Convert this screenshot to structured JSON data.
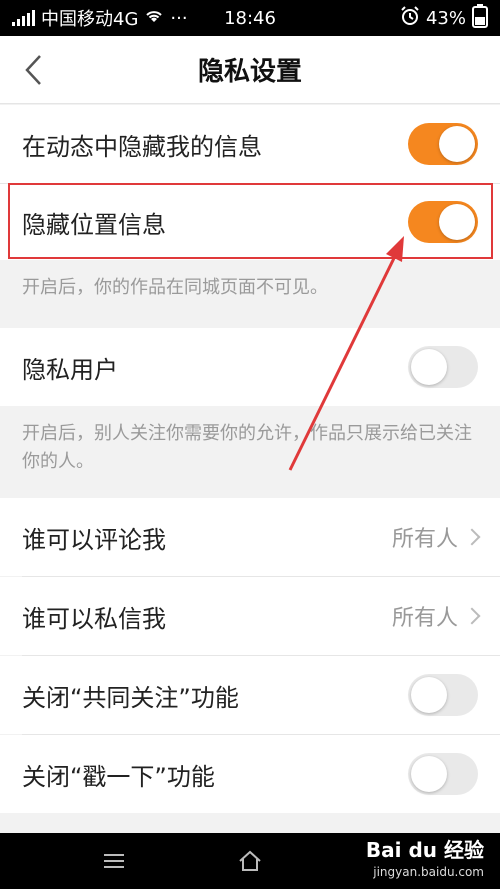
{
  "status_bar": {
    "carrier": "中国移动4G",
    "more": "···",
    "time": "18:46",
    "battery": "43%"
  },
  "nav": {
    "title": "隐私设置"
  },
  "settings": {
    "hide_in_feed": {
      "label": "在动态中隐藏我的信息",
      "enabled": true
    },
    "hide_location": {
      "label": "隐藏位置信息",
      "enabled": true,
      "hint": "开启后，你的作品在同城页面不可见。"
    },
    "private_user": {
      "label": "隐私用户",
      "enabled": false,
      "hint": "开启后，别人关注你需要你的允许，作品只展示给已关注你的人。"
    },
    "who_can_comment": {
      "label": "谁可以评论我",
      "value": "所有人"
    },
    "who_can_message": {
      "label": "谁可以私信我",
      "value": "所有人"
    },
    "close_common_follow": {
      "label": "关闭“共同关注”功能",
      "enabled": false
    },
    "close_poke": {
      "label": "关闭“戳一下”功能",
      "enabled": false
    }
  },
  "watermark": {
    "brand": "Bai du 经验",
    "site": "jingyan.baidu.com"
  },
  "colors": {
    "accent": "#f5871f",
    "highlight": "#e0393a"
  }
}
